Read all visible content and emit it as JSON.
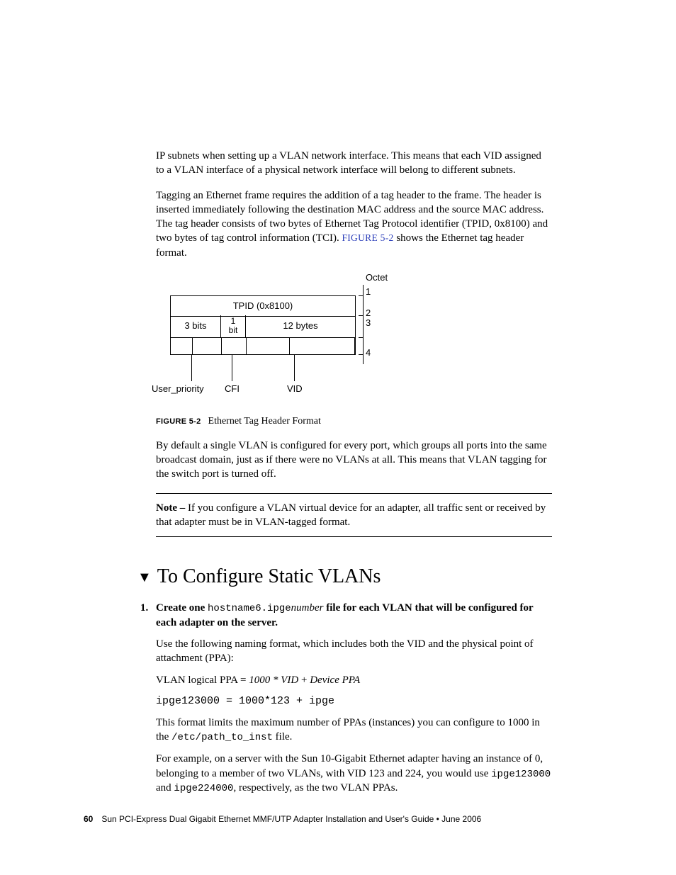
{
  "para1": "IP subnets when setting up a VLAN network interface. This means that each VID assigned to a VLAN interface of a physical network interface will belong to different subnets.",
  "para2a": "Tagging an Ethernet frame requires the addition of a tag header to the frame. The header is inserted immediately following the destination MAC address and the source MAC address. The tag header consists of two bytes of Ethernet Tag Protocol identifier (TPID, 0x8100) and two bytes of tag control information (TCI). ",
  "xref": "FIGURE 5-2",
  "para2b": " shows the Ethernet tag header format.",
  "figure": {
    "octet_label": "Octet",
    "octets": {
      "o1": "1",
      "o2": "2",
      "o3": "3",
      "o4": "4"
    },
    "tpid": "TPID (0x8100)",
    "cell_3bits": "3 bits",
    "cell_1bit_a": "1",
    "cell_1bit_b": "bit",
    "cell_12b": "12 bytes",
    "lbl_user_priority": "User_priority",
    "lbl_cfi": "CFI",
    "lbl_vid": "VID"
  },
  "figcap_num": "FIGURE 5-2",
  "figcap_title": "Ethernet Tag Header Format",
  "para3": "By default a single VLAN is configured for every port, which groups all ports into the same broadcast domain, just as if there were no VLANs at all. This means that VLAN tagging for the switch port is turned off.",
  "note_lead": "Note – ",
  "note_body": "If you configure a VLAN virtual device for an adapter, all traffic sent or received by that adapter must be in VLAN-tagged format.",
  "section_title": "To Configure Static VLANs",
  "step1_num": "1.",
  "step1_a": "Create one ",
  "step1_code": "hostname6.ipge",
  "step1_var": "number",
  "step1_b": " file for each VLAN that will be configured for each adapter on the server.",
  "p_use": "Use the following naming format, which includes both the VID and the physical point of attachment (PPA):",
  "formula_a": "VLAN logical PPA = ",
  "formula_b": "1000 * VID",
  "formula_c": " + ",
  "formula_d": "Device PPA",
  "formula_code": "ipge123000 = 1000*123 + ipge",
  "p_limit_a": "This format limits the maximum number of PPAs (instances) you can configure to 1000 in the ",
  "p_limit_code": "/etc/path_to_inst",
  "p_limit_b": " file.",
  "p_ex_a": "For example, on a server with the Sun 10-Gigabit Ethernet adapter having an instance of 0, belonging to a member of two VLANs, with VID 123 and 224, you would use ",
  "p_ex_code1": "ipge123000",
  "p_ex_mid": " and ",
  "p_ex_code2": "ipge224000",
  "p_ex_b": ", respectively, as the two VLAN PPAs.",
  "footer_page": "60",
  "footer_text": "Sun PCI-Express Dual Gigabit Ethernet MMF/UTP Adapter Installation and User's Guide  •  June 2006"
}
